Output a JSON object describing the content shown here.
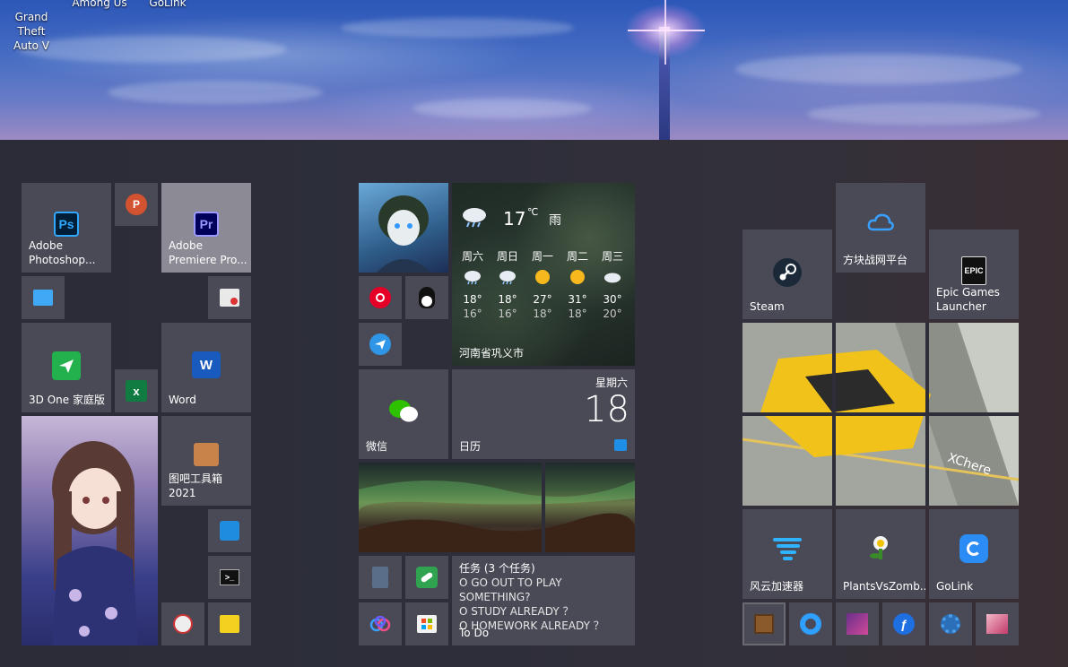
{
  "desktop": {
    "icons": [
      {
        "label": "Grand Theft\nAuto V"
      },
      {
        "label": "Among Us"
      },
      {
        "label": "GoLink"
      }
    ]
  },
  "tiles": {
    "photoshop": {
      "label": "Adobe\nPhotoshop...",
      "icon": "Ps"
    },
    "powerpoint": {
      "icon": "P"
    },
    "premiere": {
      "label": "Adobe\nPremiere Pro...",
      "icon": "Pr"
    },
    "one3d": {
      "label": "3D One 家庭版"
    },
    "excel": {
      "icon": "x"
    },
    "word": {
      "label": "Word",
      "icon": "W"
    },
    "tuba": {
      "label": "图吧工具箱\n2021"
    },
    "netease_music": {
      "icon": "netease-music-icon"
    },
    "qq": {
      "icon": "qq-penguin-icon"
    },
    "wechat": {
      "label": "微信"
    },
    "calendar": {
      "label": "日历",
      "weekday": "星期六",
      "day": "18"
    },
    "steam": {
      "label": "Steam"
    },
    "fangkuai": {
      "label": "方块战网平台"
    },
    "epic": {
      "label": "Epic Games\nLauncher",
      "icon": "EPIC"
    },
    "xchere": {
      "label": "XChere"
    },
    "fengyun": {
      "label": "风云加速器"
    },
    "pvz": {
      "label": "PlantsVsZomb..."
    },
    "golink": {
      "label": "GoLink"
    }
  },
  "weather": {
    "current_temp": "17",
    "unit": "℃",
    "condition": "雨",
    "location": "河南省巩义市",
    "forecast": [
      {
        "day": "周六",
        "high": "18°",
        "low": "16°",
        "icon": "rain-cloud-icon"
      },
      {
        "day": "周日",
        "high": "18°",
        "low": "16°",
        "icon": "rain-cloud-icon"
      },
      {
        "day": "周一",
        "high": "27°",
        "low": "18°",
        "icon": "sun-icon"
      },
      {
        "day": "周二",
        "high": "31°",
        "low": "18°",
        "icon": "sun-icon"
      },
      {
        "day": "周三",
        "high": "30°",
        "low": "20°",
        "icon": "cloud-icon"
      }
    ]
  },
  "todo": {
    "title": "任务 (3 个任务)",
    "items": [
      "O GO OUT TO PLAY SOMETHING?",
      "O STUDY ALREADY ？",
      "O HOMEWORK ALREADY ？"
    ],
    "app": "To Do"
  },
  "colors": {
    "tile_bg": "#4a4a56",
    "tile_highlight": "#8c8b95",
    "start_bg": "#2b2c37",
    "photoshop_blue": "#31a8ff",
    "premiere_purple": "#9999ff",
    "steam_blue": "#1b2838"
  }
}
